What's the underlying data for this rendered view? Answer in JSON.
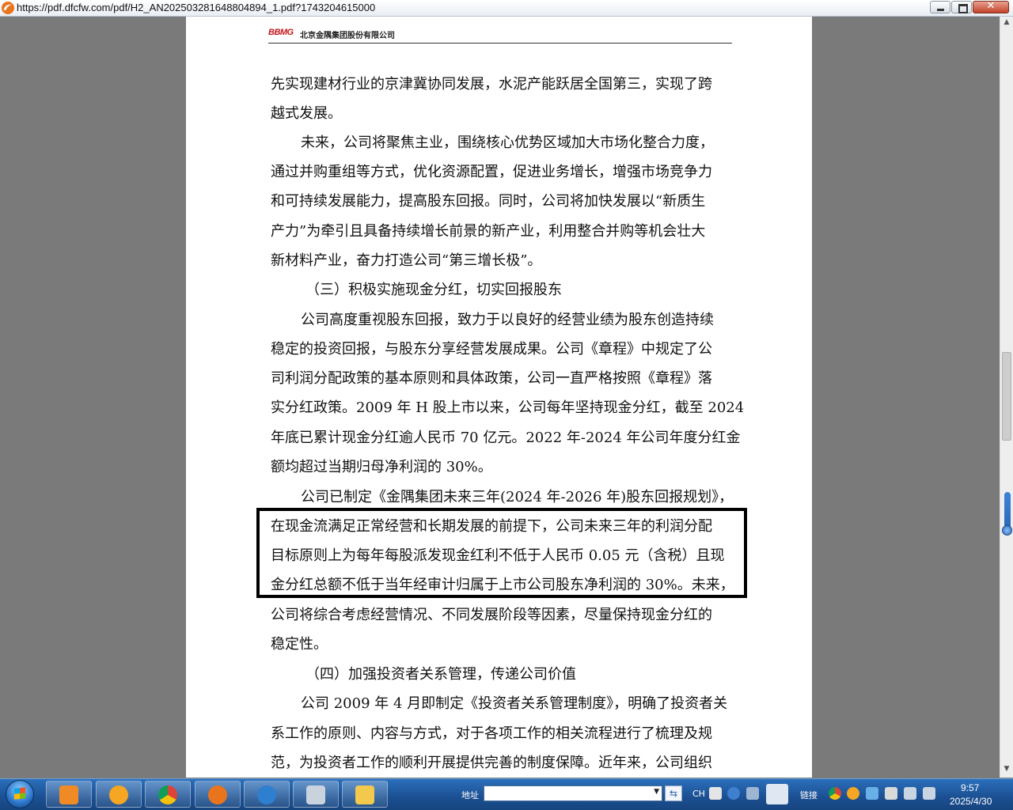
{
  "window": {
    "url": "https://pdf.dfcfw.com/pdf/H2_AN202503281648804894_1.pdf?1743204615000",
    "close_glyph": "✕"
  },
  "page_header": {
    "logo": "BBMG",
    "company": "北京金隅集团股份有限公司"
  },
  "body_lines": [
    "先实现建材行业的京津冀协同发展，水泥产能跃居全国第三，实现了跨",
    "越式发展。",
    "未来，公司将聚焦主业，围绕核心优势区域加大市场化整合力度，",
    "通过并购重组等方式，优化资源配置，促进业务增长，增强市场竞争力",
    "和可持续发展能力，提高股东回报。同时，公司将加快发展以“新质生",
    "产力”为牵引且具备持续增长前景的新产业，利用整合并购等机会壮大",
    "新材料产业，奋力打造公司“第三增长极”。",
    "（三）积极实施现金分红，切实回报股东",
    "公司高度重视股东回报，致力于以良好的经营业绩为股东创造持续",
    "稳定的投资回报，与股东分享经营发展成果。公司《章程》中规定了公",
    "司利润分配政策的基本原则和具体政策，公司一直严格按照《章程》落",
    "实分红政策。2009 年 H 股上市以来，公司每年坚持现金分红，截至 2024",
    "年底已累计现金分红逾人民币 70 亿元。2022 年-2024 年公司年度分红金",
    "额均超过当期归母净利润的 30%。",
    "公司已制定《金隅集团未来三年(2024 年-2026 年)股东回报规划》，",
    "在现金流满足正常经营和长期发展的前提下，公司未来三年的利润分配",
    "目标原则上为每年每股派发现金红利不低于人民币 0.05 元（含税）且现",
    "金分红总额不低于当年经审计归属于上市公司股东净利润的 30%。未来，",
    "公司将综合考虑经营情况、不同发展阶段等因素，尽量保持现金分红的",
    "稳定性。",
    "（四）加强投资者关系管理，传递公司价值",
    "公司 2009 年 4 月即制定《投资者关系管理制度》，明确了投资者关",
    "系工作的原则、内容与方式，对于各项工作的相关流程进行了梳理及规",
    "范，为投资者工作的顺利开展提供完善的制度保障。近年来，公司组织"
  ],
  "taskbar": {
    "address_label": "地址",
    "address_value": "",
    "links_label": "链接",
    "lang": "CH",
    "time": "9:57",
    "date": "2025/4/30"
  }
}
